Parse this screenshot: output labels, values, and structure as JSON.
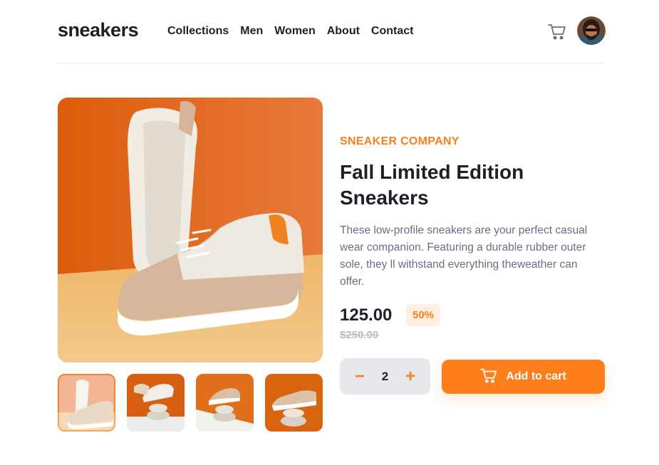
{
  "brand_logo": "sneakers",
  "nav": {
    "items": [
      {
        "label": "Collections"
      },
      {
        "label": "Men"
      },
      {
        "label": "Women"
      },
      {
        "label": "About"
      },
      {
        "label": "Contact"
      }
    ]
  },
  "header": {
    "cart_icon": "cart-icon",
    "avatar_icon": "user-avatar"
  },
  "gallery": {
    "main_image": "white and tan low-profile sneakers on orange background",
    "thumbnails": [
      {
        "name": "thumbnail-1",
        "active": true
      },
      {
        "name": "thumbnail-2",
        "active": false
      },
      {
        "name": "thumbnail-3",
        "active": false
      },
      {
        "name": "thumbnail-4",
        "active": false
      }
    ]
  },
  "product": {
    "company": "SNEAKER COMPANY",
    "title_line1": "Fall Limited Edition",
    "title_line2": "Sneakers",
    "description": "These low-profile sneakers are your perfect casual wear companion. Featuring a durable rubber outer sole, they ll withstand everything theweather can offer.",
    "price": "125.00",
    "discount": "50%",
    "original_price": "$250.00"
  },
  "cart_controls": {
    "minus": "−",
    "quantity": "2",
    "plus": "+",
    "add_label": "Add to cart"
  },
  "colors": {
    "accent": "#ff7e1b",
    "accent_light": "#ffeee2",
    "text_dark": "#1d2026",
    "text_muted": "#69707d",
    "stepper_bg": "#e6e8ec"
  }
}
